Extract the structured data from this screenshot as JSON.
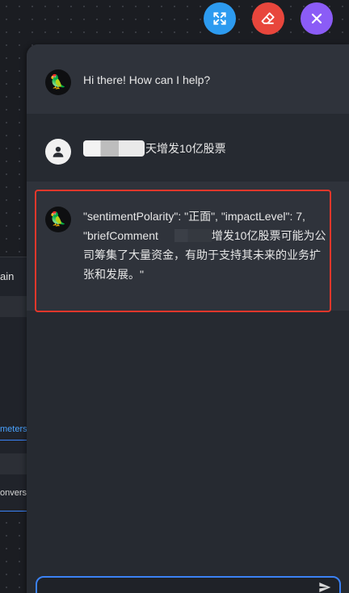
{
  "toolbar": {
    "expand_icon": "expand-arrows-icon",
    "clear_icon": "eraser-icon",
    "close_icon": "close-x-icon",
    "colors": {
      "expand": "#2d9bf0",
      "clear": "#e8463c",
      "close": "#8b5cf6"
    }
  },
  "background_panel": {
    "title_fragment": "ain",
    "tab_fragment": "meters",
    "item_fragment": "onversa"
  },
  "chat": {
    "messages": [
      {
        "role": "bot",
        "avatar": "parrot-icon",
        "text": "Hi there! How can I help?"
      },
      {
        "role": "user",
        "avatar": "user-icon",
        "text_suffix": "天增发10亿股票"
      },
      {
        "role": "bot",
        "avatar": "parrot-icon",
        "text_part1": "\"sentimentPolarity\": \"正面\", \"impactLevel\": 7, \"briefComment",
        "text_part2": "增发10亿股票可能为公司筹集了大量资金，有助于支持其未来的业务扩张和发展。\""
      }
    ],
    "highlight_color": "#e5372b"
  },
  "input": {
    "placeholder": "",
    "send_icon": "send-icon",
    "border_color": "#3b82f6"
  }
}
